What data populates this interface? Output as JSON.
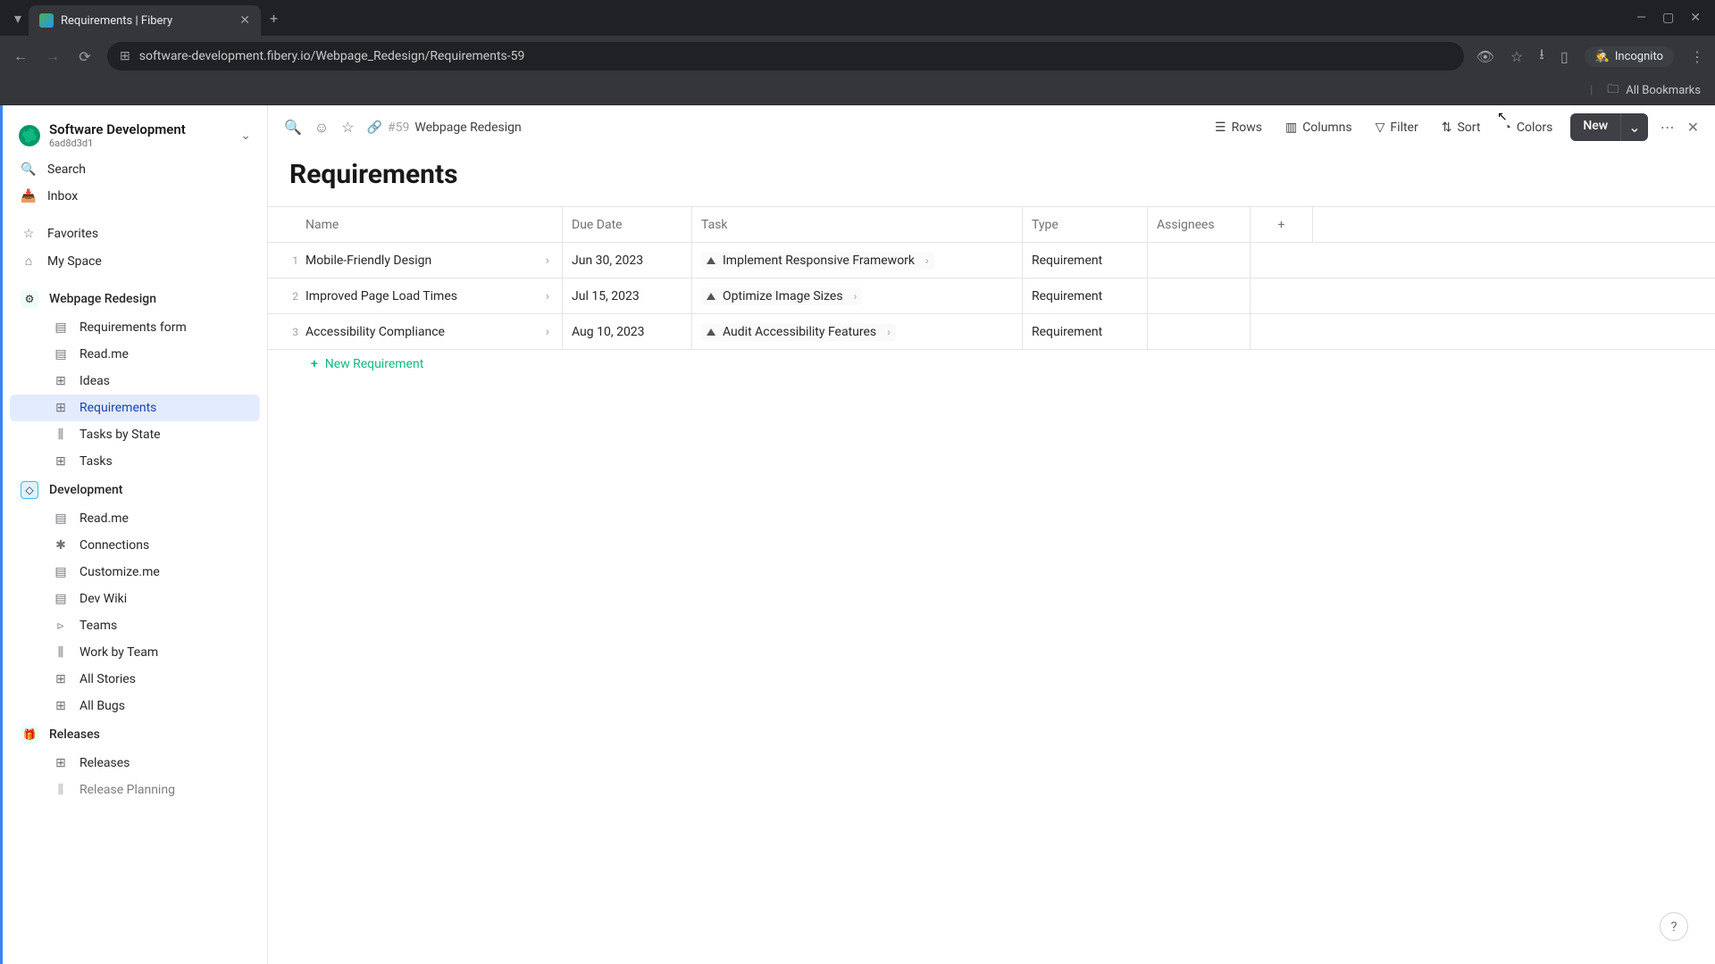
{
  "browser": {
    "tab_title": "Requirements | Fibery",
    "url": "software-development.fibery.io/Webpage_Redesign/Requirements-59",
    "incognito": "Incognito",
    "all_bookmarks": "All Bookmarks"
  },
  "workspace": {
    "name": "Software Development",
    "id": "6ad8d3d1"
  },
  "sidebar": {
    "search": "Search",
    "inbox": "Inbox",
    "favorites": "Favorites",
    "my_space": "My Space",
    "spaces": {
      "webpage_redesign": {
        "label": "Webpage Redesign",
        "items": [
          "Requirements form",
          "Read.me",
          "Ideas",
          "Requirements",
          "Tasks by State",
          "Tasks"
        ]
      },
      "development": {
        "label": "Development",
        "items": [
          "Read.me",
          "Connections",
          "Customize.me",
          "Dev Wiki",
          "Teams",
          "Work by Team",
          "All Stories",
          "All Bugs"
        ]
      },
      "releases": {
        "label": "Releases",
        "items": [
          "Releases",
          "Release Planning"
        ]
      }
    }
  },
  "topbar": {
    "crumb_num": "#59",
    "crumb_title": "Webpage Redesign",
    "rows": "Rows",
    "columns": "Columns",
    "filter": "Filter",
    "sort": "Sort",
    "colors": "Colors",
    "new": "New"
  },
  "page_title": "Requirements",
  "table": {
    "headers": {
      "name": "Name",
      "due": "Due Date",
      "task": "Task",
      "type": "Type",
      "assignees": "Assignees"
    },
    "rows": [
      {
        "num": "1",
        "name": "Mobile-Friendly Design",
        "due": "Jun 30, 2023",
        "task": "Implement Responsive Framework",
        "type": "Requirement"
      },
      {
        "num": "2",
        "name": "Improved Page Load Times",
        "due": "Jul 15, 2023",
        "task": "Optimize Image Sizes",
        "type": "Requirement"
      },
      {
        "num": "3",
        "name": "Accessibility Compliance",
        "due": "Aug 10, 2023",
        "task": "Audit Accessibility Features",
        "type": "Requirement"
      }
    ],
    "new_row": "New Requirement"
  },
  "help": "?"
}
